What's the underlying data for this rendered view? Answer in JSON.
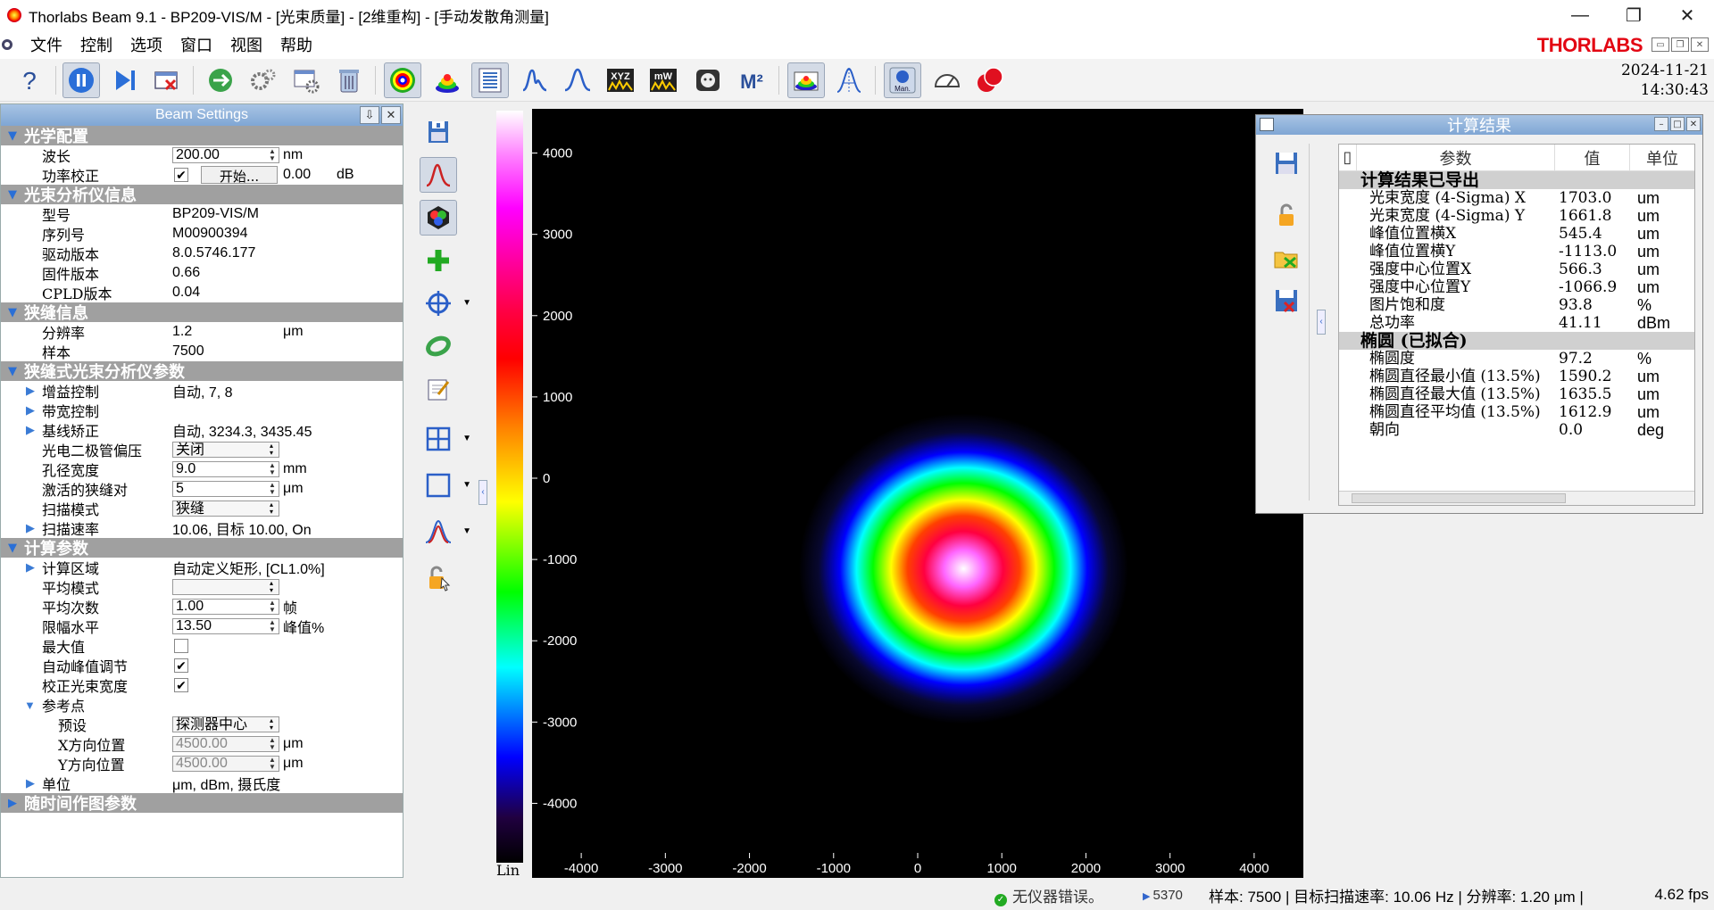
{
  "window": {
    "title": "Thorlabs Beam 9.1 - BP209-VIS/M - [光束质量] - [2维重构] - [手动发散角测量]",
    "minimize": "—",
    "restore": "❐",
    "close": "✕"
  },
  "menu": {
    "items": [
      "文件",
      "控制",
      "选项",
      "窗口",
      "视图",
      "帮助"
    ],
    "brand": "THORLABS"
  },
  "clock": {
    "date": "2024-11-21",
    "time": "14:30:43"
  },
  "toolbar": {
    "icons": [
      "help-icon",
      "pause-icon",
      "step-icon",
      "close-detector-icon",
      "network-icon",
      "settings-gears-icon",
      "config-icon",
      "clear-icon",
      "2d-view-icon",
      "3d-view-icon",
      "results-table-icon",
      "beam-profile-icon",
      "gauss-fit-icon",
      "xyz-icon",
      "mw-icon",
      "camera-icon",
      "m2-icon",
      "color-profile-icon",
      "divergence-icon",
      "manual-icon",
      "gauge-icon",
      "record-icon"
    ],
    "xyz_label": "XYZ",
    "mw_label": "mW",
    "m2_label": "M²",
    "manual_label": "Man."
  },
  "settings": {
    "title": "Beam Settings",
    "sections": {
      "optical": "光学配置",
      "analyzer_info": "光束分析仪信息",
      "slit_info": "狭缝信息",
      "slit_params": "狭缝式光束分析仪参数",
      "calc_params": "计算参数",
      "timechart": "随时间作图参数"
    },
    "wavelength": {
      "label": "波长",
      "value": "200.00",
      "unit": "nm"
    },
    "power_correction": {
      "label": "功率校正",
      "checked": "✔",
      "button": "开始...",
      "value": "0.00",
      "unit": "dB"
    },
    "model": {
      "label": "型号",
      "value": "BP209-VIS/M"
    },
    "serial": {
      "label": "序列号",
      "value": "M00900394"
    },
    "driver": {
      "label": "驱动版本",
      "value": "8.0.5746.177"
    },
    "firmware": {
      "label": "固件版本",
      "value": "0.66"
    },
    "cpld": {
      "label": "CPLD版本",
      "value": "0.04"
    },
    "resolution": {
      "label": "分辨率",
      "value": "1.2",
      "unit": "μm"
    },
    "samples": {
      "label": "样本",
      "value": "7500"
    },
    "gain": {
      "label": "增益控制",
      "value": "自动, 7, 8"
    },
    "bandwidth": {
      "label": "带宽控制",
      "value": ""
    },
    "baseline": {
      "label": "基线矫正",
      "value": "自动, 3234.3, 3435.45"
    },
    "photodiode_bias": {
      "label": "光电二极管偏压",
      "value": "关闭"
    },
    "aperture": {
      "label": "孔径宽度",
      "value": "9.0",
      "unit": "mm"
    },
    "active_slit": {
      "label": "激活的狭缝对",
      "value": "5",
      "unit": "μm"
    },
    "scan_mode": {
      "label": "扫描模式",
      "value": "狭缝"
    },
    "scan_rate": {
      "label": "扫描速率",
      "value": "10.06, 目标 10.00, On"
    },
    "calc_area": {
      "label": "计算区域",
      "value": "自动定义矩形, [CL1.0%]"
    },
    "avg_mode": {
      "label": "平均模式",
      "value": ""
    },
    "avg_count": {
      "label": "平均次数",
      "value": "1.00",
      "unit": "帧"
    },
    "clip_level": {
      "label": "限幅水平",
      "value": "13.50",
      "unit": "峰值%"
    },
    "max_value": {
      "label": "最大值",
      "checked": ""
    },
    "auto_peak": {
      "label": "自动峰值调节",
      "checked": "✔"
    },
    "correct_width": {
      "label": "校正光束宽度",
      "checked": "✔"
    },
    "ref_point": {
      "label": "参考点"
    },
    "preset": {
      "label": "预设",
      "value": "探测器中心"
    },
    "x_pos": {
      "label": "X方向位置",
      "value": "4500.00",
      "unit": "μm"
    },
    "y_pos": {
      "label": "Y方向位置",
      "value": "4500.00",
      "unit": "μm"
    },
    "units": {
      "label": "单位",
      "value": "μm, dBm, 摄氏度"
    }
  },
  "colorbar": {
    "label": "Lin"
  },
  "chart_data": {
    "type": "heatmap",
    "title": "",
    "xlabel": "",
    "ylabel": "",
    "xlim": [
      -4500,
      4500
    ],
    "ylim": [
      -4500,
      4500
    ],
    "x_ticks": [
      -4000,
      -3000,
      -2000,
      -1000,
      0,
      1000,
      2000,
      3000,
      4000
    ],
    "y_ticks": [
      4000,
      3000,
      2000,
      1000,
      0,
      -1000,
      -2000,
      -3000,
      -4000
    ],
    "x_tick_labels": [
      "-4000",
      "-3000",
      "-2000",
      "-1000",
      "0",
      "1000",
      "2000",
      "3000",
      "4000"
    ],
    "y_tick_labels": [
      "4000",
      "3000",
      "2000",
      "1000",
      "0",
      "-1000",
      "-2000",
      "-3000",
      "-4000"
    ],
    "beam_center": [
      545.4,
      -1113.0
    ],
    "beam_width_x": 1703.0,
    "beam_width_y": 1661.8,
    "colormap": [
      "#000000",
      "#0000ff",
      "#00ffff",
      "#00ff00",
      "#ffff00",
      "#ff8000",
      "#ff0000",
      "#ff00ff",
      "#ffffff"
    ]
  },
  "results": {
    "title": "计算结果",
    "headers": {
      "param": "参数",
      "value": "值",
      "unit": "单位"
    },
    "groups": [
      {
        "name": "计算结果已导出",
        "rows": [
          {
            "param": "光束宽度 (4-Sigma) X",
            "value": "1703.0",
            "unit": "um"
          },
          {
            "param": "光束宽度 (4-Sigma) Y",
            "value": "1661.8",
            "unit": "um"
          },
          {
            "param": "峰值位置横X",
            "value": "545.4",
            "unit": "um"
          },
          {
            "param": "峰值位置横Y",
            "value": "-1113.0",
            "unit": "um"
          },
          {
            "param": "强度中心位置X",
            "value": "566.3",
            "unit": "um"
          },
          {
            "param": "强度中心位置Y",
            "value": "-1066.9",
            "unit": "um"
          },
          {
            "param": "图片饱和度",
            "value": "93.8",
            "unit": "%"
          },
          {
            "param": "总功率",
            "value": "41.11",
            "unit": "dBm"
          }
        ]
      },
      {
        "name": "椭圆 (已拟合)",
        "rows": [
          {
            "param": "椭圆度",
            "value": "97.2",
            "unit": "%"
          },
          {
            "param": "椭圆直径最小值 (13.5%)",
            "value": "1590.2",
            "unit": "um"
          },
          {
            "param": "椭圆直径最大值 (13.5%)",
            "value": "1635.5",
            "unit": "um"
          },
          {
            "param": "椭圆直径平均值 (13.5%)",
            "value": "1612.9",
            "unit": "um"
          },
          {
            "param": "朝向",
            "value": "0.0",
            "unit": "deg"
          }
        ]
      }
    ]
  },
  "status": {
    "device": "无仪器错误。",
    "frame": "5370",
    "info": "样本: 7500 | 目标扫描速率: 10.06 Hz | 分辨率: 1.20 μm |",
    "fps": "4.62 fps"
  }
}
